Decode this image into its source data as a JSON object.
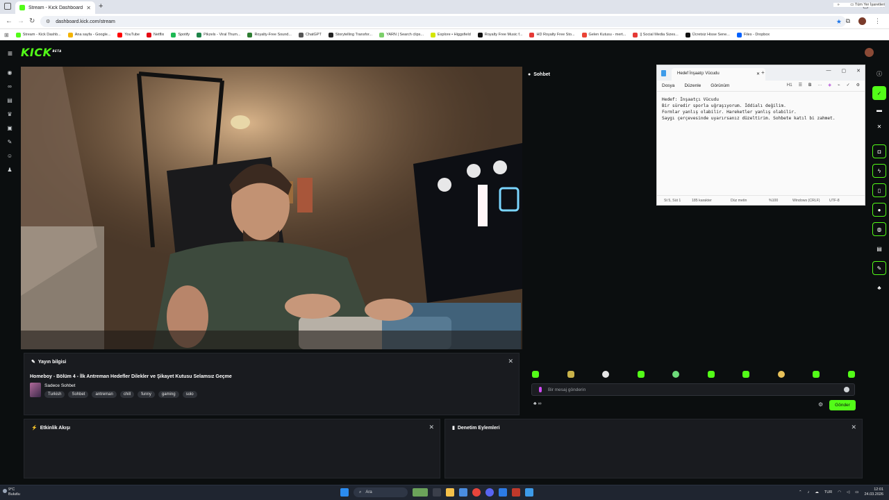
{
  "browser": {
    "tab_title": "Stream - Kick Dashboard",
    "url": "dashboard.kick.com/stream",
    "bookmarks": [
      {
        "label": "Stream - Kick Dashb...",
        "color": "#53fc18"
      },
      {
        "label": "Ana sayfa - Google...",
        "color": "#f4b400"
      },
      {
        "label": "YouTube",
        "color": "#ff0000"
      },
      {
        "label": "Netflix",
        "color": "#e50914"
      },
      {
        "label": "Spotify",
        "color": "#1db954"
      },
      {
        "label": "Pikzels - Viral Thum...",
        "color": "#1e8449"
      },
      {
        "label": "Royalty-Free Sound...",
        "color": "#2e7d32"
      },
      {
        "label": "ChatGPT",
        "color": "#555555"
      },
      {
        "label": "Storytelling Transfor...",
        "color": "#222222"
      },
      {
        "label": "YARN | Search clips...",
        "color": "#7ccf6a"
      },
      {
        "label": "Explore • Higgsfield",
        "color": "#d4e600"
      },
      {
        "label": "Royalty Free Music f...",
        "color": "#111111"
      },
      {
        "label": "HD Royalty Free Sto...",
        "color": "#e53935"
      },
      {
        "label": "Gelen Kutusu - mert...",
        "color": "#ea4335"
      },
      {
        "label": "|| Social Media Sizes...",
        "color": "#e53935"
      },
      {
        "label": "Ücretsiz Hisse Sene...",
        "color": "#111111"
      },
      {
        "label": "Files - Dropbox",
        "color": "#0061fe"
      }
    ],
    "all_bookmarks": "Tüm Yer İşaretleri"
  },
  "kick": {
    "logo": "KICK",
    "logo_badge": "BETA",
    "stream_info": {
      "header": "Yayın bilgisi",
      "title": "Homeboy - Bölüm 4 - İlk Antreman Hedefler Dilekler ve Şikayet Kutusu Selamsız Geçme",
      "category": "Sadece Sohbet",
      "tags": [
        "Turkish",
        "Sohbet",
        "antreman",
        "chill",
        "funny",
        "gaming",
        "solo"
      ]
    },
    "chat": {
      "header": "Sohbet",
      "placeholder": "Bir mesaj gönderin",
      "send": "Gönder"
    },
    "activity": {
      "header": "Etkinlik Akışı"
    },
    "moderation": {
      "header": "Denetim Eylemleri"
    }
  },
  "notepad": {
    "tab_title": "Hedef İnşaatçı Vücudu",
    "menu": [
      "Dosya",
      "Düzenle",
      "Görünüm"
    ],
    "heading_level": "H1",
    "lines": [
      "Hedef: İnşaatçı Vücudu",
      "Bir süredir sporla uğraşıyorum. İddialı değilim.",
      "Formlar yanlış olabilir. Hareketler yanlış olabilir.",
      "Saygı çerçevesinde uyarırsanız düzeltirim. Sohbete katıl bi zahmet."
    ],
    "status": {
      "position": "St 5, Süt 1",
      "chars": "185 karakter",
      "format": "Düz metin",
      "zoom": "%100",
      "eol": "Windows (CRLF)",
      "encoding": "UTF-8"
    }
  },
  "taskbar": {
    "temp": "9°C",
    "weather": "Bulutlu",
    "search": "Ara",
    "lang": "TUR",
    "time": "12:01",
    "date": "24.03.2026"
  },
  "colors": {
    "accent": "#53fc18",
    "panel": "#191b1f",
    "bg": "#0b0e0f"
  }
}
